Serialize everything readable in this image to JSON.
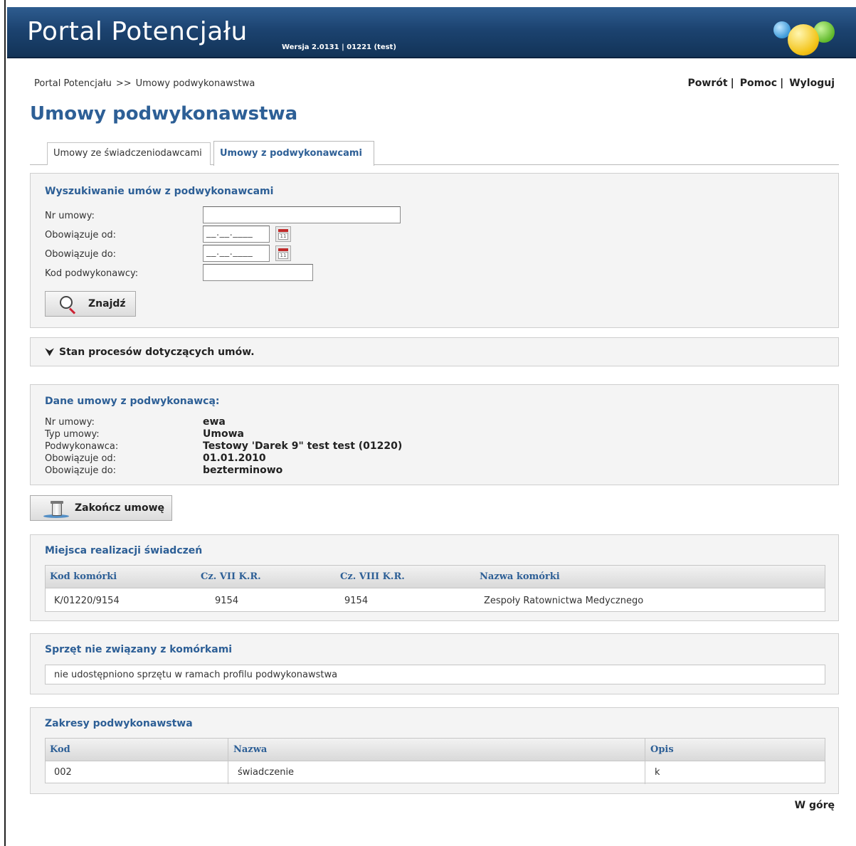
{
  "app": {
    "title": "Portal Potencjału",
    "version": "Wersja 2.0131 | 01221 (test)"
  },
  "breadcrumb": [
    "Portal Potencjału",
    ">>",
    "Umowy podwykonawstwa"
  ],
  "top_links": {
    "back": "Powrót",
    "help": "Pomoc",
    "logout": "Wyloguj",
    "separator": "|"
  },
  "page_title": "Umowy podwykonawstwa",
  "tabs": [
    {
      "label": "Umowy ze świadczeniodawcami",
      "active": false
    },
    {
      "label": "Umowy z podwykonawcami",
      "active": true
    }
  ],
  "search": {
    "title": "Wyszukiwanie umów z podwykonawcami",
    "fields": {
      "contract_no": {
        "label": "Nr umowy:",
        "value": ""
      },
      "valid_from": {
        "label": "Obowiązuje od:",
        "value": "__.__.____"
      },
      "valid_to": {
        "label": "Obowiązuje do:",
        "value": "__.__.____"
      },
      "subcontractor_code": {
        "label": "Kod podwykonawcy:",
        "value": ""
      }
    },
    "find_button": "Znajdź"
  },
  "status_section": {
    "label": "Stan procesów dotyczących umów."
  },
  "details": {
    "title": "Dane umowy z podwykonawcą:",
    "rows": [
      {
        "label": "Nr umowy:",
        "value": "ewa"
      },
      {
        "label": "Typ umowy:",
        "value": "Umowa"
      },
      {
        "label": "Podwykonawca:",
        "value": "Testowy 'Darek 9\" test test (01220)"
      },
      {
        "label": "Obowiązuje od:",
        "value": "01.01.2010"
      },
      {
        "label": "Obowiązuje do:",
        "value": "bezterminowo"
      }
    ]
  },
  "end_contract_button": "Zakończ umowę",
  "locations": {
    "title": "Miejsca realizacji świadczeń",
    "columns": [
      "Kod komórki",
      "Cz. VII K.R.",
      "Cz. VIII K.R.",
      "Nazwa komórki"
    ],
    "rows": [
      [
        "K/01220/9154",
        "9154",
        "9154",
        "Zespoły Ratownictwa Medycznego"
      ]
    ]
  },
  "equipment": {
    "title": "Sprzęt nie związany z komórkami",
    "message": "nie udostępniono sprzętu w ramach profilu podwykonawstwa"
  },
  "scopes": {
    "title": "Zakresy podwykonawstwa",
    "columns": [
      "Kod",
      "Nazwa",
      "Opis"
    ],
    "rows": [
      [
        "002",
        "świadczenie",
        "k"
      ]
    ]
  },
  "back_to_top": "W górę",
  "colors": {
    "header_blue": "#1c4370",
    "accent_blue": "#2d5f96",
    "panel_bg": "#f4f4f4"
  }
}
